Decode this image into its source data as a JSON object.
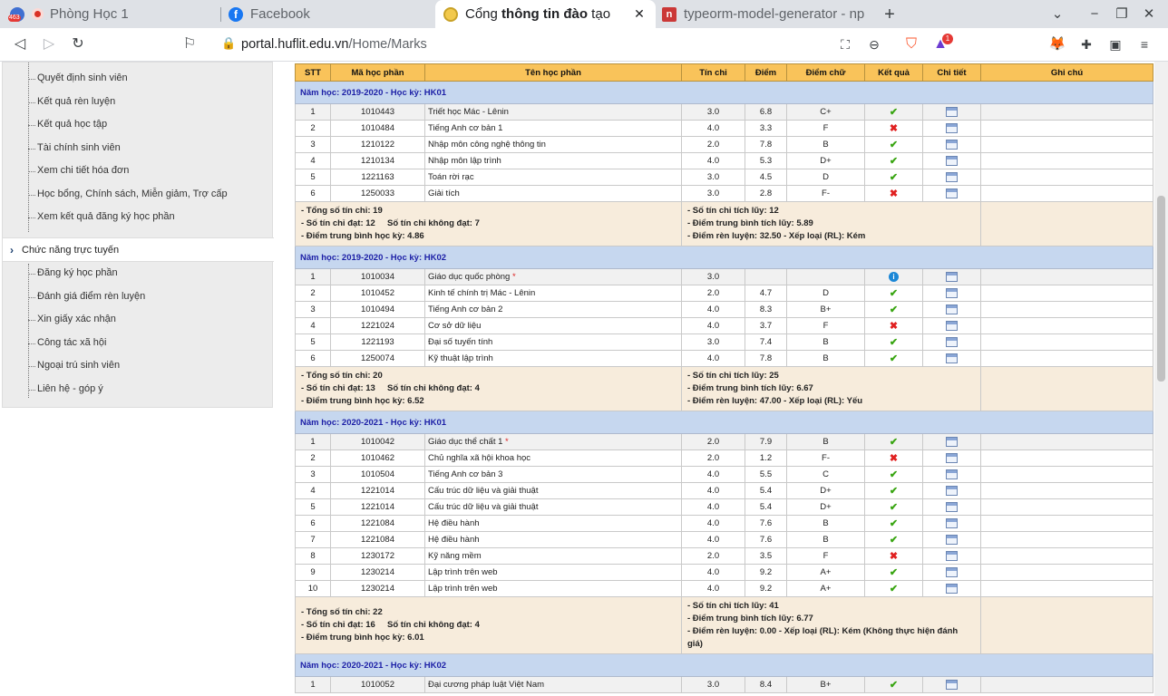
{
  "browser": {
    "tabs": [
      {
        "title": "Phòng Học 1",
        "badge": "463",
        "active": false
      },
      {
        "title": "Facebook",
        "active": false
      },
      {
        "title_pre": "Cổng ",
        "title_bold": "thông tin đào",
        "title_post": " tạo",
        "active": true
      },
      {
        "title": "typeorm-model-generator - np",
        "active": false
      }
    ],
    "url_host": "portal.huflit.edu.vn",
    "url_path": "/Home/Marks",
    "ext_badge": "1",
    "accent": "#f9c35a"
  },
  "sidebar": {
    "group1": [
      "Quyết định sinh viên",
      "Kết quả rèn luyện",
      "Kết quả học tập",
      "Tài chính sinh viên",
      "Xem chi tiết hóa đơn",
      "Học bổng, Chính sách, Miễn giảm, Trợ cấp",
      "Xem kết quả đăng ký học phần"
    ],
    "section": "Chức năng trực tuyến",
    "group2": [
      "Đăng ký học phần",
      "Đánh giá điểm rèn luyện",
      "Xin giấy xác nhận",
      "Công tác xã hội",
      "Ngoại trú sinh viên",
      "Liên hệ - góp ý"
    ]
  },
  "table": {
    "headers": [
      "STT",
      "Mã học phần",
      "Tên học phần",
      "Tín chỉ",
      "Điểm",
      "Điểm chữ",
      "Kết quả",
      "Chi tiết",
      "Ghi chú"
    ],
    "semesters": [
      {
        "title": "Năm học: 2019-2020 - Học kỳ: HK01",
        "rows": [
          [
            "1",
            "1010443",
            "Triết học Mác - Lênin",
            "3.0",
            "6.8",
            "C+",
            "pass"
          ],
          [
            "2",
            "1010484",
            "Tiếng Anh cơ bản 1",
            "4.0",
            "3.3",
            "F",
            "fail"
          ],
          [
            "3",
            "1210122",
            "Nhập môn công nghệ thông tin",
            "2.0",
            "7.8",
            "B",
            "pass"
          ],
          [
            "4",
            "1210134",
            "Nhập môn lập trình",
            "4.0",
            "5.3",
            "D+",
            "pass"
          ],
          [
            "5",
            "1221163",
            "Toán rời rạc",
            "3.0",
            "4.5",
            "D",
            "pass"
          ],
          [
            "6",
            "1250033",
            "Giải tích",
            "3.0",
            "2.8",
            "F-",
            "fail"
          ]
        ],
        "summary_left": [
          "- Tổng số tín chỉ: 19",
          "- Số tín chỉ đạt: 12     Số tín chỉ không đạt: 7",
          "- Điểm trung bình học kỳ: 4.86"
        ],
        "summary_right": [
          "- Số tín chỉ tích lũy: 12",
          "- Điểm trung bình tích lũy: 5.89",
          "- Điểm rèn luyện: 32.50 - Xếp loại (RL): Kém"
        ]
      },
      {
        "title": "Năm học: 2019-2020 - Học kỳ: HK02",
        "rows": [
          [
            "1",
            "1010034",
            "Giáo dục quốc phòng",
            "3.0",
            "",
            "",
            "info",
            "*"
          ],
          [
            "2",
            "1010452",
            "Kinh tế chính trị Mác - Lênin",
            "2.0",
            "4.7",
            "D",
            "pass"
          ],
          [
            "3",
            "1010494",
            "Tiếng Anh cơ bản 2",
            "4.0",
            "8.3",
            "B+",
            "pass"
          ],
          [
            "4",
            "1221024",
            "Cơ sở dữ liệu",
            "4.0",
            "3.7",
            "F",
            "fail"
          ],
          [
            "5",
            "1221193",
            "Đại số tuyến tính",
            "3.0",
            "7.4",
            "B",
            "pass"
          ],
          [
            "6",
            "1250074",
            "Kỹ thuật lập trình",
            "4.0",
            "7.8",
            "B",
            "pass"
          ]
        ],
        "summary_left": [
          "- Tổng số tín chỉ: 20",
          "- Số tín chỉ đạt: 13     Số tín chỉ không đạt: 4",
          "- Điểm trung bình học kỳ: 6.52"
        ],
        "summary_right": [
          "- Số tín chỉ tích lũy: 25",
          "- Điểm trung bình tích lũy: 6.67",
          "- Điểm rèn luyện: 47.00 - Xếp loại (RL): Yếu"
        ]
      },
      {
        "title": "Năm học: 2020-2021 - Học kỳ: HK01",
        "rows": [
          [
            "1",
            "1010042",
            "Giáo dục thể chất 1",
            "2.0",
            "7.9",
            "B",
            "pass",
            "*"
          ],
          [
            "2",
            "1010462",
            "Chủ nghĩa xã hội khoa học",
            "2.0",
            "1.2",
            "F-",
            "fail"
          ],
          [
            "3",
            "1010504",
            "Tiếng Anh cơ bản 3",
            "4.0",
            "5.5",
            "C",
            "pass"
          ],
          [
            "4",
            "1221014",
            "Cấu trúc dữ liệu và giải thuật",
            "4.0",
            "5.4",
            "D+",
            "pass"
          ],
          [
            "5",
            "1221014",
            "Cấu trúc dữ liệu và giải thuật",
            "4.0",
            "5.4",
            "D+",
            "pass"
          ],
          [
            "6",
            "1221084",
            "Hệ điều hành",
            "4.0",
            "7.6",
            "B",
            "pass"
          ],
          [
            "7",
            "1221084",
            "Hệ điều hành",
            "4.0",
            "7.6",
            "B",
            "pass"
          ],
          [
            "8",
            "1230172",
            "Kỹ năng mềm",
            "2.0",
            "3.5",
            "F",
            "fail"
          ],
          [
            "9",
            "1230214",
            "Lập trình trên web",
            "4.0",
            "9.2",
            "A+",
            "pass"
          ],
          [
            "10",
            "1230214",
            "Lập trình trên web",
            "4.0",
            "9.2",
            "A+",
            "pass"
          ]
        ],
        "summary_left": [
          "- Tổng số tín chỉ: 22",
          "- Số tín chỉ đạt: 16     Số tín chỉ không đạt: 4",
          "- Điểm trung bình học kỳ: 6.01"
        ],
        "summary_right": [
          "- Số tín chỉ tích lũy: 41",
          "- Điểm trung bình tích lũy: 6.77",
          "- Điểm rèn luyện: 0.00 - Xếp loại (RL): Kém (Không thực hiện đánh giá)"
        ]
      },
      {
        "title": "Năm học: 2020-2021 - Học kỳ: HK02",
        "rows": [
          [
            "1",
            "1010052",
            "Đại cương pháp luật Việt Nam",
            "3.0",
            "8.4",
            "B+",
            "pass"
          ]
        ]
      }
    ]
  }
}
